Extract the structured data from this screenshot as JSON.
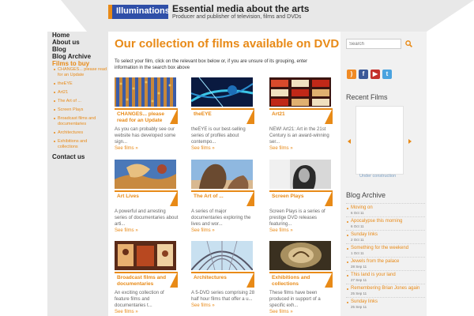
{
  "header": {
    "logo_text": "Illuminations",
    "site_title": "Essential media about the arts",
    "site_subtitle": "Producer and publisher of television, films and DVDs"
  },
  "nav": {
    "items": [
      "Home",
      "About us",
      "Blog",
      "Blog Archive"
    ],
    "active": "Films to buy",
    "sub_items": [
      "CHANGES... please read for an Update",
      "theEYE",
      "Art21",
      "The Art of ...",
      "Screen Plays",
      "Broadcast films and documentaries",
      "Architectures",
      "Exhibitions and collections"
    ],
    "contact": "Contact us"
  },
  "main": {
    "title": "Our collection of films available on DVD",
    "intro": "To select your film, click on the relevant box below or, if you are unsure of its grouping, enter information in the search box above",
    "see_films": "See films »",
    "cards": [
      {
        "title": "CHANGES... please read for an Update",
        "desc": "As you can probably see our website has developed some sign..."
      },
      {
        "title": "theEYE",
        "desc": "theEYE is our best-selling series of profiles about contempo..."
      },
      {
        "title": "Art21",
        "desc": "NEW! Art21: Art in the 21st Century is an award-winning ser..."
      },
      {
        "title": "Art Lives",
        "desc": "A powerful and arresting series of documentaries about arti..."
      },
      {
        "title": "The Art of ...",
        "desc": "A series of major documentaries exploring the lives and wor..."
      },
      {
        "title": "Screen Plays",
        "desc": "Screen Plays is a series of prestige DVD releases featuring..."
      },
      {
        "title": "Broadcast films and documentaries",
        "desc": "An exciting collection of feature films and documentaries t..."
      },
      {
        "title": "Architectures",
        "desc": "A 5-DVD series comprising 28 half hour films that offer a u..."
      },
      {
        "title": "Exhibitions and collections",
        "desc": "These films have been produced in support of a specific exh..."
      }
    ]
  },
  "sidebar": {
    "search_placeholder": "Search",
    "recent_films_title": "Recent Films",
    "under_construction": "Under construction",
    "blog_archive_title": "Blog Archive",
    "archive": [
      {
        "title": "Moving on",
        "date": "6 Oct 11"
      },
      {
        "title": "Apocalypse this morning",
        "date": "6 Oct 11"
      },
      {
        "title": "Sunday links",
        "date": "2 Oct 11"
      },
      {
        "title": "Something for the weekend",
        "date": "1 Oct 11"
      },
      {
        "title": "Jewels from the palace",
        "date": "28 Sep 11"
      },
      {
        "title": "This land is your land",
        "date": "27 Sep 11"
      },
      {
        "title": "Remembering Brian Jones again",
        "date": "25 Sep 11"
      },
      {
        "title": "Sunday links",
        "date": "25 Sep 11"
      }
    ]
  },
  "colors": {
    "accent": "#e88a17",
    "logo_blue": "#2f4fa8",
    "band_grey": "#e8e8e8"
  },
  "icons": [
    "search-icon",
    "rss-icon",
    "facebook-icon",
    "youtube-icon",
    "twitter-icon",
    "arrow-left-icon",
    "arrow-right-icon"
  ]
}
